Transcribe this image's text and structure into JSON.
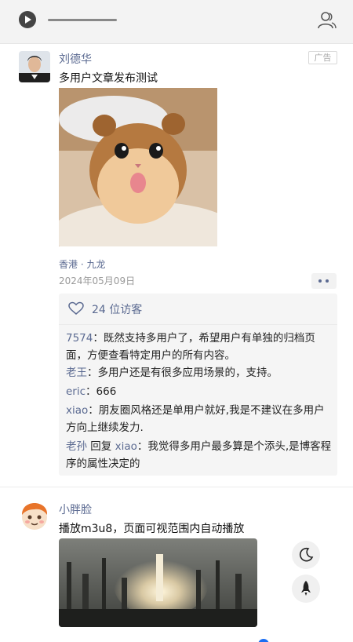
{
  "header": {
    "play_icon": "play-icon",
    "user_icon": "users-icon"
  },
  "post1": {
    "author": "刘德华",
    "ad_label": "广告",
    "text": "多用户文章发布测试",
    "location": "香港 · 九龙",
    "date": "2024年05月09日",
    "likes_label": "24 位访客",
    "comments": [
      {
        "name": "7574",
        "sep": "：",
        "text": "既然支持多用户了，希望用户有单独的归档页面，方便查看特定用户的所有内容。"
      },
      {
        "name": "老王",
        "sep": "：",
        "text": "多用户还是有很多应用场景的，支持。"
      },
      {
        "name": "eric",
        "sep": "：",
        "text": "666"
      },
      {
        "name": "xiao",
        "sep": "：",
        "text": "朋友圈风格还是单用户就好,我是不建议在多用户方向上继续发力."
      },
      {
        "name": "老孙",
        "reply_word": " 回复 ",
        "reply_to": "xiao",
        "sep": "：",
        "text": "我觉得多用户最多算是个添头,是博客程序的属性决定的"
      }
    ]
  },
  "post2": {
    "author": "小胖脸",
    "text": "播放m3u8，页面可视范围内自动播放"
  },
  "colors": {
    "accent": "#5b6a91",
    "topbar": "#f3f3f3",
    "comment_bg": "#f5f5f5"
  }
}
